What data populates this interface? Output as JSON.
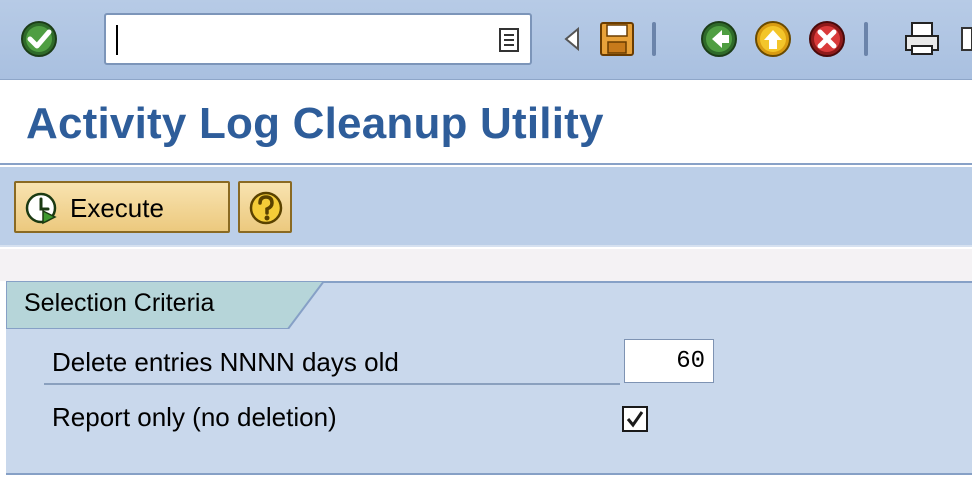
{
  "command_field": {
    "value": ""
  },
  "title": "Activity Log Cleanup Utility",
  "app_toolbar": {
    "execute_label": "Execute"
  },
  "selection": {
    "group_label": "Selection Criteria",
    "days_label": "Delete entries NNNN days old",
    "days_value": "60",
    "report_label": "Report only (no deletion)",
    "report_checked": true
  },
  "icons": {
    "enter": "checkmark-circle-icon",
    "dropdown": "dropdown-list-icon",
    "back_arrow": "triangle-left-icon",
    "save": "floppy-disk-icon",
    "back": "green-back-arrow-icon",
    "exit": "yellow-up-arrow-icon",
    "cancel": "red-cancel-icon",
    "print": "printer-icon",
    "execute": "clock-execute-icon",
    "help": "question-mark-icon"
  },
  "colors": {
    "title": "#2e5d9a",
    "toolbar": "#b7cbe6",
    "button": "#ecc97e",
    "group": "#c9d8ec"
  }
}
